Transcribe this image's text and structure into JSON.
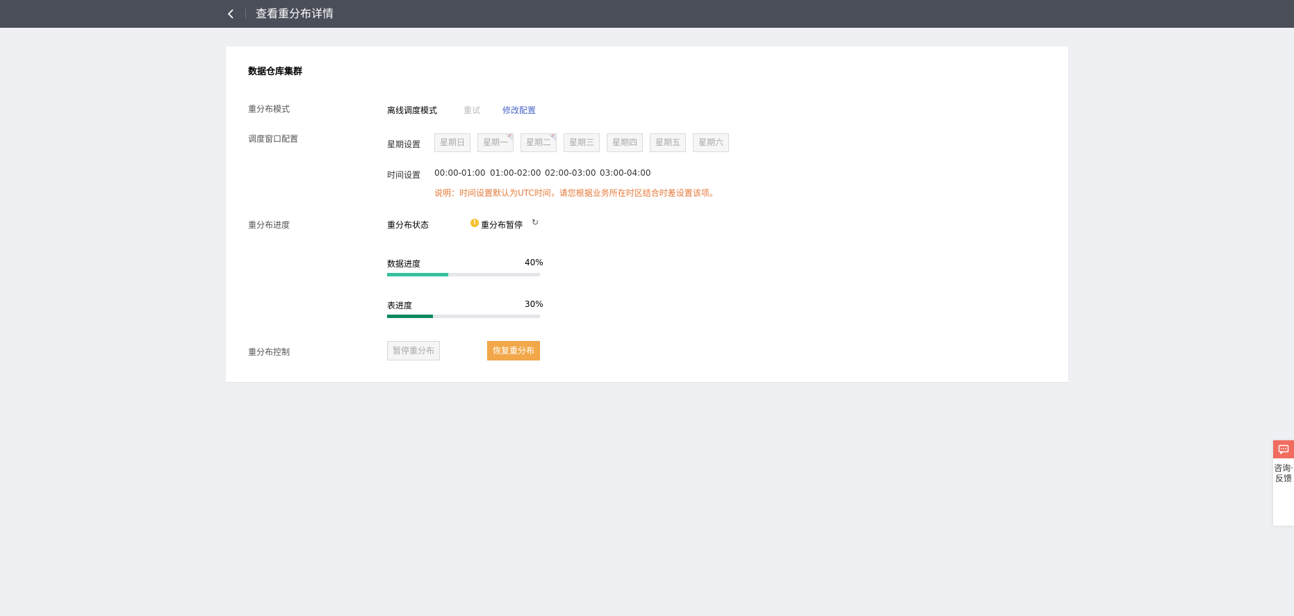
{
  "header": {
    "title": "查看重分布详情"
  },
  "card": {
    "section_title": "数据仓库集群",
    "mode": {
      "label": "重分布模式",
      "value": "离线调度模式",
      "retry": "重试",
      "edit": "修改配置"
    },
    "window": {
      "label": "调度窗口配置",
      "weekday_label": "星期设置",
      "days": [
        {
          "label": "星期日",
          "checked": false
        },
        {
          "label": "星期一",
          "checked": true
        },
        {
          "label": "星期二",
          "checked": true
        },
        {
          "label": "星期三",
          "checked": false
        },
        {
          "label": "星期四",
          "checked": false
        },
        {
          "label": "星期五",
          "checked": false
        },
        {
          "label": "星期六",
          "checked": false
        }
      ],
      "time_label": "时间设置",
      "time_slots": [
        "00:00-01:00",
        "01:00-02:00",
        "02:00-03:00",
        "03:00-04:00"
      ],
      "note": "说明：时间设置默认为UTC时间，请您根据业务所在时区结合时差设置该项。"
    },
    "progress": {
      "label": "重分布进度",
      "status_label": "重分布状态",
      "status_value": "重分布暂停",
      "data_label": "数据进度",
      "data_percent_text": "40%",
      "data_fraction": 0.4,
      "data_color": "#35c0a0",
      "table_label": "表进度",
      "table_percent_text": "30%",
      "table_fraction": 0.3,
      "table_color": "#0f8a5f"
    },
    "control": {
      "label": "重分布控制",
      "pause_button": "暂停重分布",
      "resume_button": "恢复重分布"
    }
  },
  "float_widget": {
    "text": "咨询·反馈"
  },
  "colors": {
    "topbar": "#4a4e59",
    "accent_link": "#4966c8",
    "warning": "#f5c12e",
    "note": "#e57a3a",
    "primary_button": "#f2a84a",
    "feedback_head": "#f06c5f"
  },
  "icons": {
    "back": "chevron-left-icon",
    "status": "warning-icon",
    "refresh": "refresh-icon",
    "feedback": "chat-icon"
  }
}
